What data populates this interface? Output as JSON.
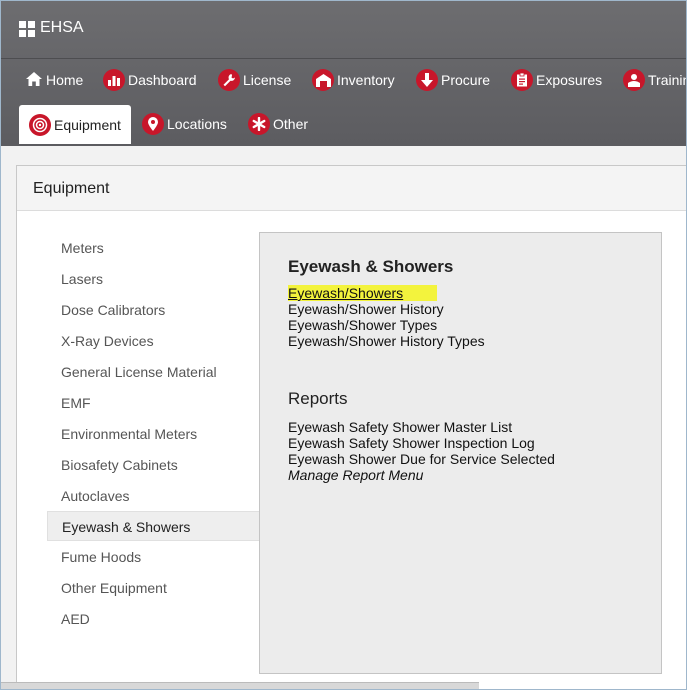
{
  "app": {
    "title": "EHSA"
  },
  "nav": {
    "row1": [
      {
        "label": "Home",
        "icon": "home-icon"
      },
      {
        "label": "Dashboard",
        "icon": "dashboard-icon"
      },
      {
        "label": "License",
        "icon": "wrench-icon"
      },
      {
        "label": "Inventory",
        "icon": "inventory-icon"
      },
      {
        "label": "Procure",
        "icon": "arrow-down-icon"
      },
      {
        "label": "Exposures",
        "icon": "clipboard-icon"
      },
      {
        "label": "Training",
        "icon": "training-icon"
      }
    ],
    "row2": [
      {
        "label": "Equipment",
        "icon": "equipment-icon"
      },
      {
        "label": "Locations",
        "icon": "location-pin-icon"
      },
      {
        "label": "Other",
        "icon": "asterisk-icon"
      }
    ]
  },
  "panel": {
    "title": "Equipment"
  },
  "sidebar": {
    "items": [
      {
        "label": "Meters"
      },
      {
        "label": "Lasers"
      },
      {
        "label": "Dose Calibrators"
      },
      {
        "label": "X-Ray Devices"
      },
      {
        "label": "General License Material"
      },
      {
        "label": "EMF"
      },
      {
        "label": "Environmental Meters"
      },
      {
        "label": "Biosafety Cabinets"
      },
      {
        "label": "Autoclaves"
      },
      {
        "label": "Eyewash & Showers"
      },
      {
        "label": "Fume Hoods"
      },
      {
        "label": "Other Equipment"
      },
      {
        "label": "AED"
      }
    ]
  },
  "content": {
    "section_title": "Eyewash & Showers",
    "links": [
      {
        "label": "Eyewash/Showers"
      },
      {
        "label": "Eyewash/Shower History"
      },
      {
        "label": "Eyewash/Shower Types"
      },
      {
        "label": "Eyewash/Shower History Types"
      }
    ],
    "reports_title": "Reports",
    "reports": [
      {
        "label": "Eyewash Safety Shower Master List"
      },
      {
        "label": "Eyewash Safety Shower Inspection Log"
      },
      {
        "label": "Eyewash Shower Due for Service Selected"
      },
      {
        "label": "Manage Report Menu"
      }
    ]
  },
  "colors": {
    "header_bg": "#626265",
    "icon_red": "#c8162a",
    "highlight": "#f3f33d"
  }
}
